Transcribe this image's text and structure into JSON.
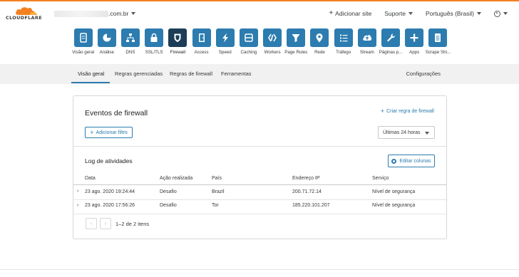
{
  "header": {
    "logo_text": "CLOUDFLARE",
    "domain_suffix": ".com.br",
    "add_site": "Adicionar site",
    "support": "Suporte",
    "language": "Português (Brasil)"
  },
  "apps": [
    {
      "label": "Visão geral",
      "icon": "overview-icon"
    },
    {
      "label": "Análise",
      "icon": "pie-chart-icon"
    },
    {
      "label": "DNS",
      "icon": "network-icon"
    },
    {
      "label": "SSL/TLS",
      "icon": "lock-icon"
    },
    {
      "label": "Firewall",
      "icon": "shield-icon",
      "active": true
    },
    {
      "label": "Access",
      "icon": "door-icon"
    },
    {
      "label": "Speed",
      "icon": "lightning-icon"
    },
    {
      "label": "Caching",
      "icon": "server-icon"
    },
    {
      "label": "Workers",
      "icon": "workers-icon"
    },
    {
      "label": "Page Rules",
      "icon": "filter-icon"
    },
    {
      "label": "Rede",
      "icon": "location-pin-icon"
    },
    {
      "label": "Tráfego",
      "icon": "list-icon"
    },
    {
      "label": "Stream",
      "icon": "cloud-upload-icon"
    },
    {
      "label": "Páginas p...",
      "icon": "wrench-icon"
    },
    {
      "label": "Apps",
      "icon": "plus-icon"
    },
    {
      "label": "Scrape Shi...",
      "icon": "document-icon"
    }
  ],
  "subnav": {
    "tabs": [
      "Visão geral",
      "Regras gerenciadas",
      "Regras de firewall",
      "Ferramentas"
    ],
    "settings": "Configurações"
  },
  "events": {
    "title": "Eventos de firewall",
    "create_rule": "Criar regra de firewall",
    "add_filter": "Adicionar filtro",
    "time_range": "Últimas 24 horas"
  },
  "log": {
    "title": "Log de atividades",
    "edit_columns": "Editar colunas",
    "columns": [
      "Data",
      "Ação realizada",
      "País",
      "Endereço IP",
      "Serviço"
    ],
    "rows": [
      [
        "23 ago. 2020 19:24:44",
        "Desafio",
        "Brazil",
        "200.71.72.14",
        "Nível de segurança"
      ],
      [
        "23 ago. 2020 17:56:26",
        "Desafio",
        "Tor",
        "185.220.101.207",
        "Nível de segurança"
      ]
    ],
    "pagination": "1–2 de 2 itens"
  },
  "colors": {
    "accent": "#2c7cb0",
    "active_tile": "#1d3c57",
    "brand_orange": "#f38020"
  }
}
